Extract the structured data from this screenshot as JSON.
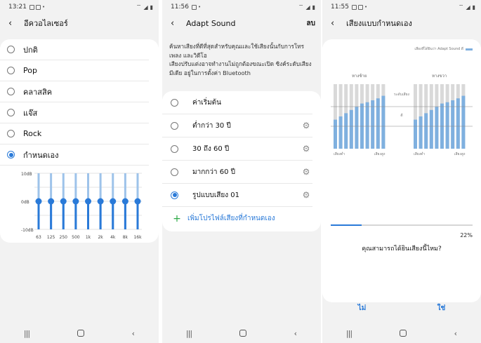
{
  "panel1": {
    "status_time": "13:21",
    "title": "อีควอไลเซอร์",
    "presets": [
      "ปกติ",
      "Pop",
      "คลาสสิค",
      "แจ๊ส",
      "Rock",
      "กำหนดเอง"
    ],
    "selected_index": 5,
    "eq": {
      "db_labels": [
        "10dB",
        "0dB",
        "-10dB"
      ],
      "bands": [
        "63",
        "125",
        "250",
        "500",
        "1k",
        "2k",
        "4k",
        "8k",
        "16k"
      ],
      "values_db": [
        0,
        0,
        0,
        0,
        0,
        0,
        0,
        0,
        0
      ],
      "accent": "#2a7ad8"
    }
  },
  "panel2": {
    "status_time": "11:56",
    "title": "Adapt Sound",
    "action": "ลบ",
    "description": "ค้นหาเสียงที่ดีที่สุดสำหรับคุณและใช้เสียงนั้นกับการโทร เพลง และวิดีโอ\nเสียงปรับแต่งอาจทำงานไม่ถูกต้องขณะเปิด ซิงค์ระดับเสียงมีเดีย อยู่ในการตั้งค่า Bluetooth",
    "options": [
      {
        "label": "ค่าเริ่มต้น",
        "has_settings": false
      },
      {
        "label": "ต่ำกว่า 30 ปี",
        "has_settings": true
      },
      {
        "label": "30 ถึง 60 ปี",
        "has_settings": true
      },
      {
        "label": "มากกว่า 60 ปี",
        "has_settings": true
      },
      {
        "label": "รูปแบบเสียง 01",
        "has_settings": true
      }
    ],
    "selected_index": 4,
    "add_label": "เพิ่มโปรไฟล์เสียงที่กำหนดเอง"
  },
  "panel3": {
    "status_time": "11:55",
    "title": "เสียงแบบกำหนดเอง",
    "legend": "เสียงที่ได้ยินว่า Adapt Sound ดี",
    "left_label": "หางซ้าย",
    "right_label": "หางขวา",
    "mid_labels": [
      "ระดับเสียง",
      "ดี"
    ],
    "x_left_start": "เสียงต่ำ",
    "x_left_end": "เสียงสูง",
    "x_right_start": "เสียงต่ำ",
    "x_right_end": "เสียงสูง",
    "left_levels": [
      0.45,
      0.5,
      0.55,
      0.6,
      0.65,
      0.7,
      0.72,
      0.75,
      0.78,
      0.82
    ],
    "right_levels": [
      0.45,
      0.5,
      0.55,
      0.6,
      0.65,
      0.7,
      0.72,
      0.75,
      0.78,
      0.82
    ],
    "progress_fraction": 0.22,
    "progress_label": "22%",
    "question": "คุณสามารถได้ยินเสียงนี้ไหม?",
    "no_label": "ไม่",
    "yes_label": "ใช่",
    "bar_color": "#7fb0df",
    "bar_bg": "#d9d9d9"
  }
}
